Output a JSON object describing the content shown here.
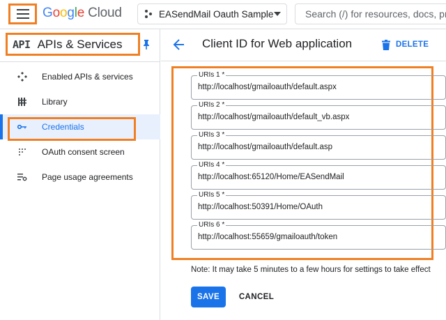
{
  "topbar": {
    "logo_google": [
      "G",
      "o",
      "o",
      "g",
      "l",
      "e"
    ],
    "logo_cloud": "Cloud",
    "project_name": "EASendMail Oauth Sample",
    "search_placeholder": "Search (/) for resources, docs, pro"
  },
  "sidebar": {
    "api_logo": "API",
    "title": "APIs & Services",
    "items": [
      {
        "label": "Enabled APIs & services",
        "icon": "hub-icon",
        "active": false
      },
      {
        "label": "Library",
        "icon": "library-icon",
        "active": false
      },
      {
        "label": "Credentials",
        "icon": "key-icon",
        "active": true
      },
      {
        "label": "OAuth consent screen",
        "icon": "consent-icon",
        "active": false
      },
      {
        "label": "Page usage agreements",
        "icon": "settings-list-icon",
        "active": false
      }
    ]
  },
  "main": {
    "title": "Client ID for Web application",
    "delete_label": "DELETE",
    "uris": [
      {
        "label": "URIs 1 *",
        "value": "http://localhost/gmailoauth/default.aspx"
      },
      {
        "label": "URIs 2 *",
        "value": "http://localhost/gmailoauth/default_vb.aspx"
      },
      {
        "label": "URIs 3 *",
        "value": "http://localhost/gmailoauth/default.asp"
      },
      {
        "label": "URIs 4 *",
        "value": "http://localhost:65120/Home/EASendMail"
      },
      {
        "label": "URIs 5 *",
        "value": "http://localhost:50391/Home/OAuth"
      },
      {
        "label": "URIs 6 *",
        "value": "http://localhost:55659/gmailoauth/token"
      }
    ],
    "note": "Note: It may take 5 minutes to a few hours for settings to take effect",
    "save_label": "SAVE",
    "cancel_label": "CANCEL"
  },
  "colors": {
    "highlight_orange": "#f07f23",
    "accent_blue": "#1a73e8",
    "active_bg": "#e8f0fe"
  }
}
